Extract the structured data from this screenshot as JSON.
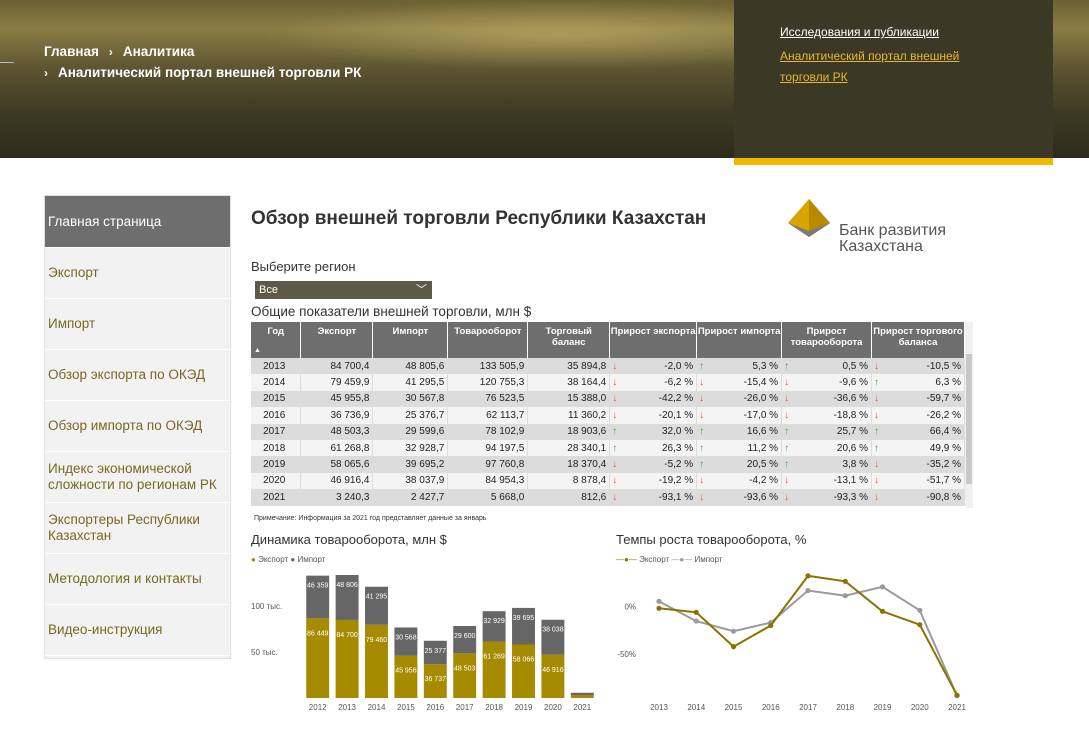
{
  "breadcrumb": {
    "home": "Главная",
    "analytics": "Аналитика",
    "current": "Аналитический портал внешней торговли РК"
  },
  "top_links": {
    "research": "Исследования и публикации",
    "portal": "Аналитический портал внешней торговли РК"
  },
  "sidebar": {
    "items": [
      {
        "label": "Главная страница"
      },
      {
        "label": "Экспорт"
      },
      {
        "label": "Импорт"
      },
      {
        "label": "Обзор экспорта по ОКЭД"
      },
      {
        "label": "Обзор импорта по ОКЭД"
      },
      {
        "label": "Индекс экономической сложности по регионам РК"
      },
      {
        "label": "Экспортеры Республики Казахстан"
      },
      {
        "label": "Методология и контакты"
      },
      {
        "label": "Видео-инструкция"
      }
    ]
  },
  "page": {
    "title": "Обзор внешней торговли Республики Казахстан",
    "logo_text": "Банк развития Казахстана",
    "region_label": "Выберите регион",
    "region_value": "Все",
    "table_title": "Общие показатели внешней торговли, млн $",
    "note": "Примечание: Информация за 2021 год представляет данные за январь"
  },
  "table": {
    "headers": [
      "Год",
      "Экспорт",
      "Импорт",
      "Товарооборот",
      "Торговый баланс",
      "Прирост экспорта",
      "Прирост импорта",
      "Прирост товарооборота",
      "Прирост торгового баланса"
    ],
    "rows": [
      {
        "year": "2013",
        "export": "84 700,4",
        "import": "48 805,6",
        "turnover": "133 505,9",
        "balance": "35 894,8",
        "g_exp": "-2,0 %",
        "g_exp_dir": "down",
        "g_imp": "5,3 %",
        "g_imp_dir": "up",
        "g_turn": "0,5 %",
        "g_turn_dir": "up",
        "g_bal": "-10,5 %",
        "g_bal_dir": "down"
      },
      {
        "year": "2014",
        "export": "79 459,9",
        "import": "41 295,5",
        "turnover": "120 755,3",
        "balance": "38 164,4",
        "g_exp": "-6,2 %",
        "g_exp_dir": "down",
        "g_imp": "-15,4 %",
        "g_imp_dir": "down",
        "g_turn": "-9,6 %",
        "g_turn_dir": "down",
        "g_bal": "6,3 %",
        "g_bal_dir": "up"
      },
      {
        "year": "2015",
        "export": "45 955,8",
        "import": "30 567,8",
        "turnover": "76 523,5",
        "balance": "15 388,0",
        "g_exp": "-42,2 %",
        "g_exp_dir": "down",
        "g_imp": "-26,0 %",
        "g_imp_dir": "down",
        "g_turn": "-36,6 %",
        "g_turn_dir": "down",
        "g_bal": "-59,7 %",
        "g_bal_dir": "down"
      },
      {
        "year": "2016",
        "export": "36 736,9",
        "import": "25 376,7",
        "turnover": "62 113,7",
        "balance": "11 360,2",
        "g_exp": "-20,1 %",
        "g_exp_dir": "down",
        "g_imp": "-17,0 %",
        "g_imp_dir": "down",
        "g_turn": "-18,8 %",
        "g_turn_dir": "down",
        "g_bal": "-26,2 %",
        "g_bal_dir": "down"
      },
      {
        "year": "2017",
        "export": "48 503,3",
        "import": "29 599,6",
        "turnover": "78 102,9",
        "balance": "18 903,6",
        "g_exp": "32,0 %",
        "g_exp_dir": "up",
        "g_imp": "16,6 %",
        "g_imp_dir": "up",
        "g_turn": "25,7 %",
        "g_turn_dir": "up",
        "g_bal": "66,4 %",
        "g_bal_dir": "up"
      },
      {
        "year": "2018",
        "export": "61 268,8",
        "import": "32 928,7",
        "turnover": "94 197,5",
        "balance": "28 340,1",
        "g_exp": "26,3 %",
        "g_exp_dir": "up",
        "g_imp": "11,2 %",
        "g_imp_dir": "up",
        "g_turn": "20,6 %",
        "g_turn_dir": "up",
        "g_bal": "49,9 %",
        "g_bal_dir": "up"
      },
      {
        "year": "2019",
        "export": "58 065,6",
        "import": "39 695,2",
        "turnover": "97 760,8",
        "balance": "18 370,4",
        "g_exp": "-5,2 %",
        "g_exp_dir": "down",
        "g_imp": "20,5 %",
        "g_imp_dir": "up",
        "g_turn": "3,8 %",
        "g_turn_dir": "up",
        "g_bal": "-35,2 %",
        "g_bal_dir": "down"
      },
      {
        "year": "2020",
        "export": "46 916,4",
        "import": "38 037,9",
        "turnover": "84 954,3",
        "balance": "8 878,4",
        "g_exp": "-19,2 %",
        "g_exp_dir": "down",
        "g_imp": "-4,2 %",
        "g_imp_dir": "down",
        "g_turn": "-13,1 %",
        "g_turn_dir": "down",
        "g_bal": "-51,7 %",
        "g_bal_dir": "down"
      },
      {
        "year": "2021",
        "export": "3 240,3",
        "import": "2 427,7",
        "turnover": "5 668,0",
        "balance": "812,6",
        "g_exp": "-93,1 %",
        "g_exp_dir": "down",
        "g_imp": "-93,6 %",
        "g_imp_dir": "down",
        "g_turn": "-93,3 %",
        "g_turn_dir": "down",
        "g_bal": "-90,8 %",
        "g_bal_dir": "down"
      }
    ]
  },
  "colors": {
    "export": "#a68b00",
    "import": "#666666",
    "accent": "#f0b800"
  },
  "chart_data": [
    {
      "type": "bar",
      "title": "Динамика товарооборота, млн $",
      "stacked": true,
      "categories": [
        "2012",
        "2013",
        "2014",
        "2015",
        "2016",
        "2017",
        "2018",
        "2019",
        "2020",
        "2021"
      ],
      "series": [
        {
          "name": "Экспорт",
          "values": [
            86449,
            84700,
            79460,
            45956,
            36737,
            48503,
            61269,
            58066,
            46916,
            3240
          ],
          "labels": [
            "86 449",
            "84 700",
            "79 460",
            "45 956",
            "36 737",
            "48 503",
            "61 269",
            "58 066",
            "46 916",
            ""
          ]
        },
        {
          "name": "Импорт",
          "values": [
            46359,
            48806,
            41295,
            30568,
            25377,
            29600,
            32929,
            39695,
            38038,
            2428
          ],
          "labels": [
            "46 359",
            "48 806",
            "41 295",
            "30 568",
            "25 377",
            "29 600",
            "32 929",
            "39 695",
            "38 038",
            ""
          ]
        }
      ],
      "yticks": [
        {
          "v": 100000,
          "label": "100 тыс."
        },
        {
          "v": 50000,
          "label": "50 тыс."
        }
      ],
      "ylim": [
        0,
        140000
      ],
      "grid": false,
      "legend": "top-left"
    },
    {
      "type": "line",
      "title": "Темпы роста товарооборота, %",
      "categories": [
        "2013",
        "2014",
        "2015",
        "2016",
        "2017",
        "2018",
        "2019",
        "2020",
        "2021"
      ],
      "series": [
        {
          "name": "Экспорт",
          "values": [
            -2.0,
            -6.2,
            -42.2,
            -20.1,
            32.0,
            26.3,
            -5.2,
            -19.2,
            -93.1
          ]
        },
        {
          "name": "Импорт",
          "values": [
            5.3,
            -15.4,
            -26.0,
            -17.0,
            16.6,
            11.2,
            20.5,
            -4.2,
            -93.6
          ]
        }
      ],
      "yticks": [
        {
          "v": 0,
          "label": "0%"
        },
        {
          "v": -50,
          "label": "-50%"
        }
      ],
      "ylim": [
        -95,
        35
      ],
      "grid": false,
      "legend": "top-left"
    }
  ]
}
